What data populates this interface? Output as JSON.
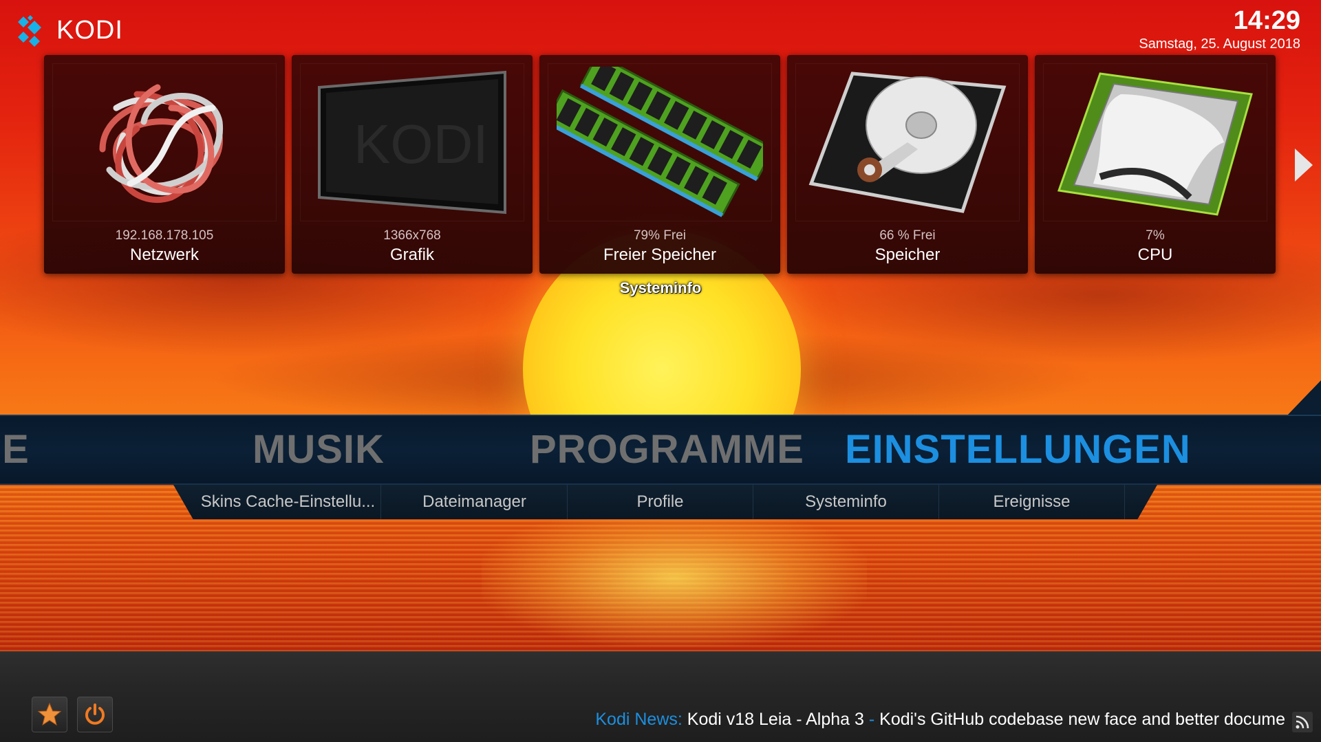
{
  "app": {
    "name": "KODI"
  },
  "clock": {
    "time": "14:29",
    "date": "Samstag, 25. August 2018"
  },
  "tiles": [
    {
      "sub": "192.168.178.105",
      "label": "Netzwerk",
      "icon": "network-cable-icon"
    },
    {
      "sub": "1366x768",
      "label": "Grafik",
      "icon": "display-icon"
    },
    {
      "sub": "79% Frei",
      "label": "Freier Speicher",
      "icon": "ram-icon"
    },
    {
      "sub": "66 % Frei",
      "label": "Speicher",
      "icon": "hard-disk-icon"
    },
    {
      "sub": "7%",
      "label": "CPU",
      "icon": "cpu-icon"
    }
  ],
  "group_label": "Systeminfo",
  "main_menu": {
    "items": [
      "IE",
      "MUSIK",
      "PROGRAMME",
      "EINSTELLUNGEN"
    ],
    "active": "EINSTELLUNGEN"
  },
  "submenu": {
    "items": [
      "Skins Cache-Einstellu...",
      "Dateimanager",
      "Profile",
      "Systeminfo",
      "Ereignisse"
    ]
  },
  "footer": {
    "favourites_icon": "star-icon",
    "power_icon": "power-icon",
    "news_label": "Kodi News:",
    "news_item1": "Kodi v18 Leia - Alpha 3",
    "news_sep": " - ",
    "news_item2": "Kodi's GitHub codebase new face and better docume",
    "rss_icon": "rss-icon"
  },
  "colors": {
    "accent": "#1c8fe0",
    "menu_inactive": "#6f6f6f",
    "menu_bar": "#0b2036"
  }
}
